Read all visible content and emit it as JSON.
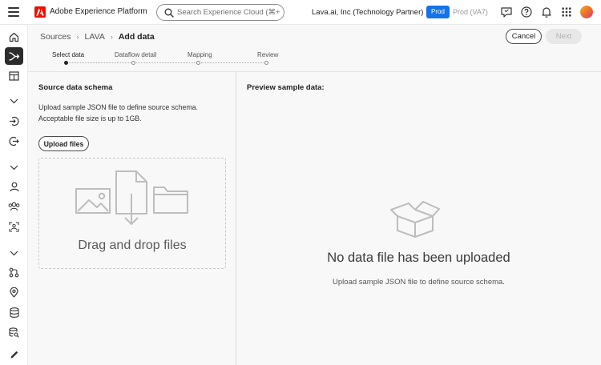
{
  "header": {
    "app_title": "Adobe Experience Platform",
    "search_placeholder": "Search Experience Cloud (⌘+/)",
    "org_name": "Lava.ai, Inc (Technology Partner)",
    "env_active": "Prod",
    "env_secondary": "Prod (VA7)",
    "icons": [
      "hamburger-icon",
      "adobe-logo-icon",
      "search-icon",
      "feedback-icon",
      "help-icon",
      "notifications-icon",
      "apps-grid-icon",
      "avatar"
    ],
    "colors": {
      "brand": "#eb1000",
      "env_badge": "#1473e6"
    }
  },
  "rail": {
    "icons": [
      "home-icon",
      "sources-icon",
      "dashboards-icon",
      "chevron-down-icon",
      "ingest-icon",
      "destinations-icon",
      "chevron-down-icon",
      "profile-icon",
      "audiences-icon",
      "identity-icon",
      "chevron-down-icon",
      "workflow-icon",
      "location-icon",
      "datasets-icon",
      "queries-icon",
      "edit-icon"
    ],
    "active": "sources-icon"
  },
  "breadcrumb": {
    "items": [
      "Sources",
      "LAVA"
    ],
    "current": "Add data"
  },
  "actions": {
    "cancel_label": "Cancel",
    "next_label": "Next"
  },
  "stepper": {
    "steps": [
      "Select data",
      "Dataflow detail",
      "Mapping",
      "Review"
    ],
    "active_index": 0
  },
  "left_panel": {
    "title": "Source data schema",
    "description": "Upload sample JSON file to define source schema. Acceptable file size is up to 1GB.",
    "upload_label": "Upload files",
    "drop_text": "Drag and drop files"
  },
  "right_panel": {
    "title": "Preview sample data:",
    "empty_title": "No data file has been uploaded",
    "empty_desc": "Upload sample JSON file to define source schema."
  }
}
